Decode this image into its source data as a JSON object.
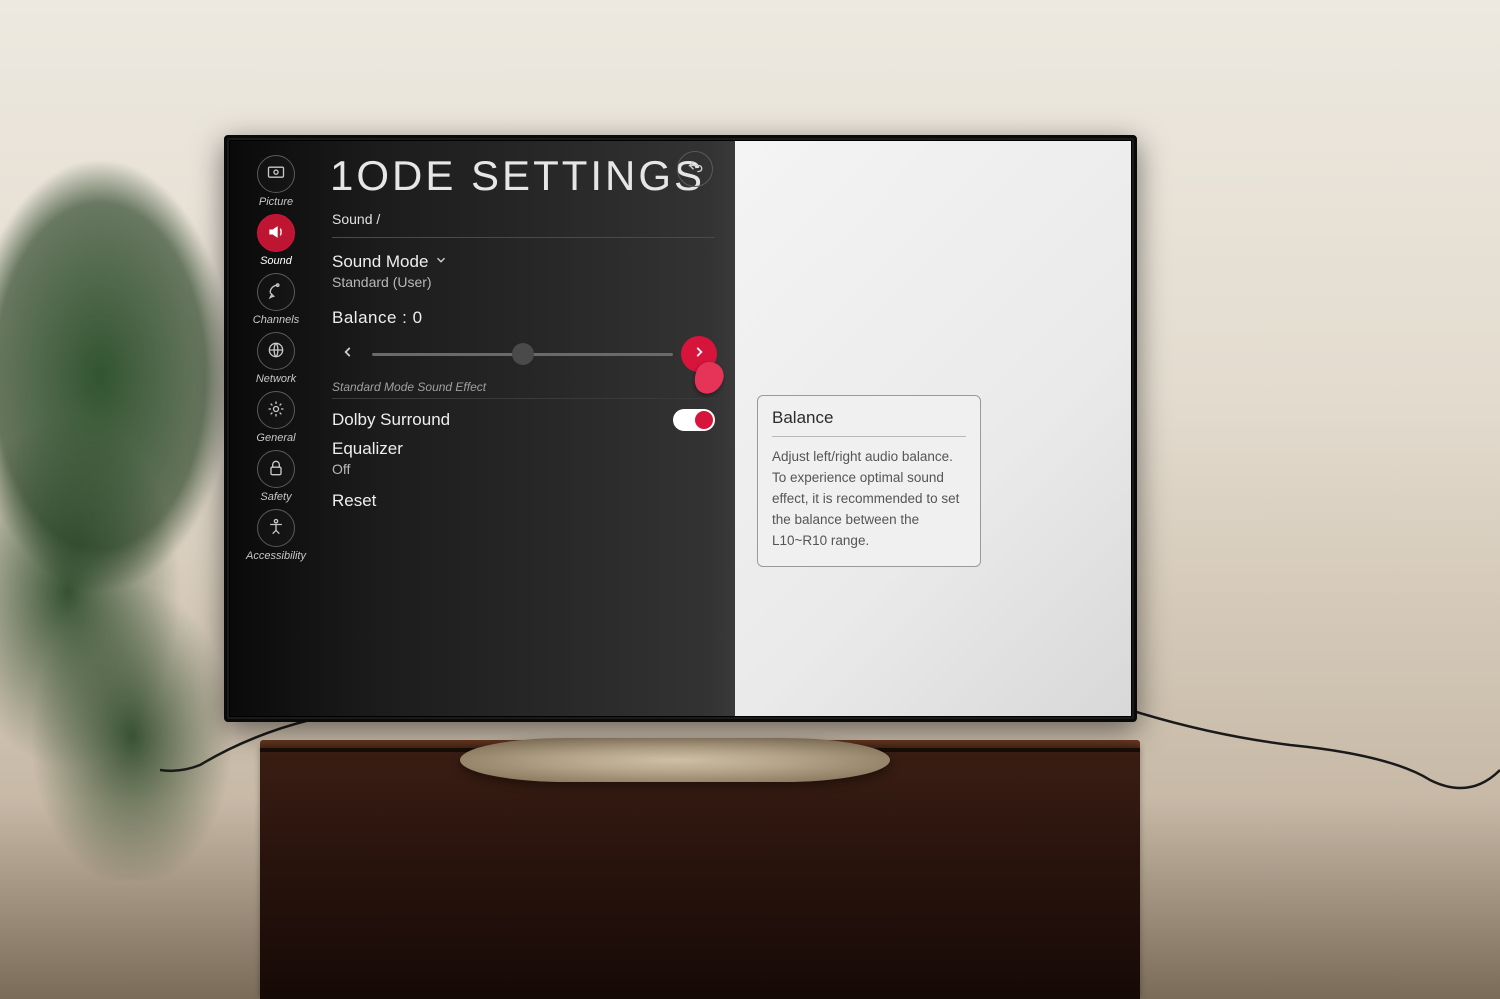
{
  "sidebar": {
    "items": [
      {
        "label": "Picture",
        "icon": "display-icon"
      },
      {
        "label": "Sound",
        "icon": "speaker-icon"
      },
      {
        "label": "Channels",
        "icon": "satellite-icon"
      },
      {
        "label": "Network",
        "icon": "globe-icon"
      },
      {
        "label": "General",
        "icon": "gear-icon"
      },
      {
        "label": "Safety",
        "icon": "lock-icon"
      },
      {
        "label": "Accessibility",
        "icon": "accessibility-icon"
      }
    ],
    "active_index": 1
  },
  "header": {
    "title": "1ODE SETTINGS",
    "breadcrumb": "Sound /"
  },
  "sound_mode": {
    "label": "Sound Mode",
    "value": "Standard (User)"
  },
  "balance": {
    "label": "Balance",
    "value": 0,
    "display": "Balance : 0"
  },
  "section_caption": "Standard Mode Sound Effect",
  "dolby": {
    "label": "Dolby Surround",
    "on": true
  },
  "equalizer": {
    "label": "Equalizer",
    "value": "Off"
  },
  "reset": {
    "label": "Reset"
  },
  "tooltip": {
    "title": "Balance",
    "body": "Adjust left/right audio balance.\nTo experience optimal sound effect, it is recommended to set the balance between the L10~R10 range."
  },
  "colors": {
    "accent": "#d6143c"
  }
}
